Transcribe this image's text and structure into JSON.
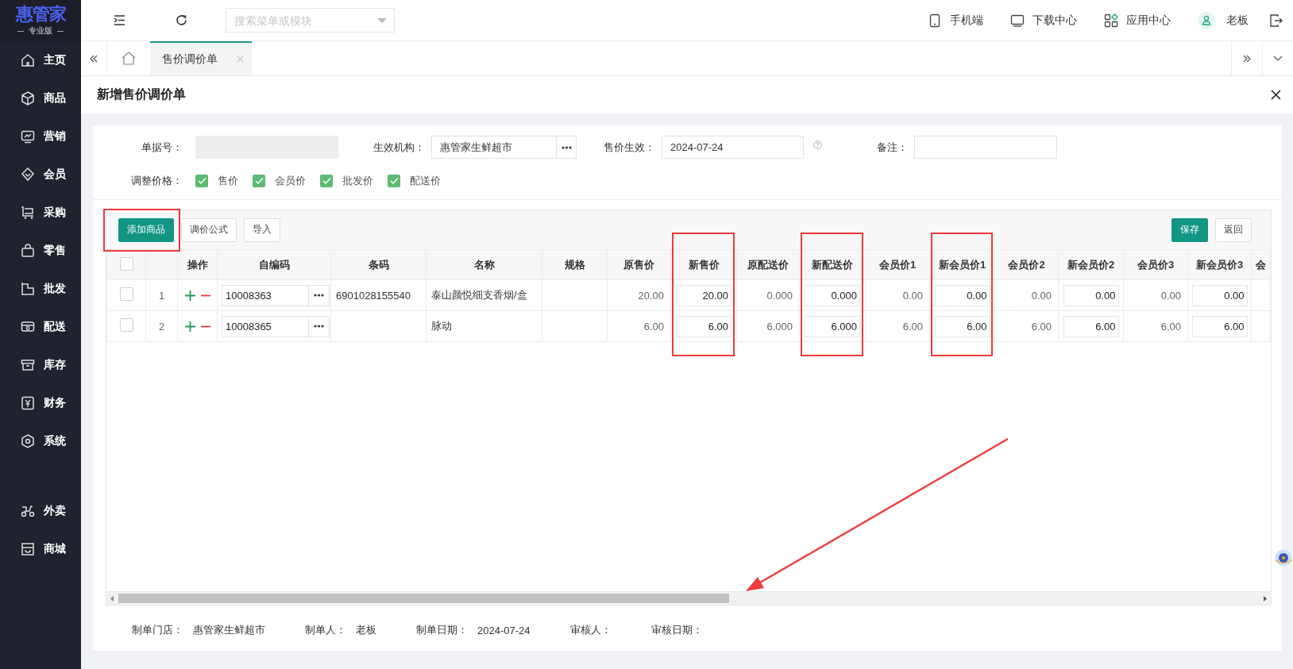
{
  "sidebar": {
    "logo": "惠管家",
    "edition": "专业版",
    "items": [
      {
        "label": "主页"
      },
      {
        "label": "商品"
      },
      {
        "label": "营销"
      },
      {
        "label": "会员"
      },
      {
        "label": "采购"
      },
      {
        "label": "零售"
      },
      {
        "label": "批发"
      },
      {
        "label": "配送"
      },
      {
        "label": "库存"
      },
      {
        "label": "财务"
      },
      {
        "label": "系统"
      }
    ],
    "bottom_items": [
      {
        "label": "外卖"
      },
      {
        "label": "商城"
      }
    ]
  },
  "topbar": {
    "search": {
      "placeholder": "搜索菜单或模块"
    },
    "links": [
      {
        "label": "手机端"
      },
      {
        "label": "下载中心"
      },
      {
        "label": "应用中心"
      }
    ],
    "user": "老板"
  },
  "tabs": [
    {
      "label": "售价调价单",
      "selected": true
    }
  ],
  "page": {
    "title": "新增售价调价单"
  },
  "form": {
    "fields": [
      {
        "label": "单据号：",
        "kind": "readonly"
      },
      {
        "label": "生效机构：",
        "kind": "lookup",
        "value": "惠管家生鲜超市"
      },
      {
        "label": "售价生效：",
        "kind": "date",
        "value": "2024-07-24"
      },
      {
        "label": "备注：",
        "kind": "text"
      }
    ],
    "adjust": {
      "label": "调整价格：",
      "options": [
        {
          "label": "售价",
          "checked": true
        },
        {
          "label": "会员价",
          "checked": true
        },
        {
          "label": "批发价",
          "checked": true
        },
        {
          "label": "配送价",
          "checked": true
        }
      ]
    }
  },
  "toolbar": {
    "left": [
      {
        "label": "添加商品",
        "kind": "primary",
        "highlighted": true
      },
      {
        "label": "调价公式",
        "kind": "default",
        "highlighted": false
      },
      {
        "label": "导入",
        "kind": "default",
        "highlighted": false
      }
    ],
    "right": [
      {
        "label": "保存",
        "kind": "primary",
        "highlighted": false
      },
      {
        "label": "返回",
        "kind": "default",
        "highlighted": false
      }
    ]
  },
  "table": {
    "all_checked": false,
    "ops_header": "操作",
    "columns": [
      {
        "label": "自编码",
        "kind": "lookup",
        "highlighted": false
      },
      {
        "label": "条码",
        "kind": "text",
        "highlighted": false
      },
      {
        "label": "名称",
        "kind": "text",
        "highlighted": false
      },
      {
        "label": "规格",
        "kind": "text",
        "highlighted": false
      },
      {
        "label": "原售价",
        "kind": "number",
        "highlighted": false
      },
      {
        "label": "新售价",
        "kind": "input",
        "highlighted": true
      },
      {
        "label": "原配送价",
        "kind": "number",
        "highlighted": false
      },
      {
        "label": "新配送价",
        "kind": "input",
        "highlighted": true
      },
      {
        "label": "会员价1",
        "kind": "number",
        "highlighted": false
      },
      {
        "label": "新会员价1",
        "kind": "input",
        "highlighted": true
      },
      {
        "label": "会员价2",
        "kind": "number",
        "highlighted": false
      },
      {
        "label": "新会员价2",
        "kind": "input",
        "highlighted": false
      },
      {
        "label": "会员价3",
        "kind": "number",
        "highlighted": false
      },
      {
        "label": "新会员价3",
        "kind": "input",
        "highlighted": false
      },
      {
        "label": "会",
        "kind": "number",
        "highlighted": false
      }
    ],
    "rows": [
      {
        "checked": false,
        "number": "1",
        "code": "10008363",
        "barcode": "6901028155540",
        "name": "泰山颜悦细支香烟/盒",
        "old_price": "20.00",
        "new_price": "20.00",
        "old_delivery": "0.000",
        "new_delivery": "0.000",
        "member1": "0.00",
        "new_member1": "0.00",
        "member2": "0.00",
        "new_member2": "0.00",
        "member3": "0.00",
        "new_member3": "0.00"
      },
      {
        "checked": false,
        "number": "2",
        "code": "10008365",
        "name": "脉动",
        "old_price": "6.00",
        "new_price": "6.00",
        "old_delivery": "6.000",
        "new_delivery": "6.000",
        "member1": "6.00",
        "new_member1": "6.00",
        "member2": "6.00",
        "new_member2": "6.00",
        "member3": "6.00",
        "new_member3": "6.00"
      }
    ]
  },
  "footer": [
    {
      "label": "制单门店：",
      "value": "惠管家生鲜超市"
    },
    {
      "label": "制单人：",
      "value": "老板"
    },
    {
      "label": "制单日期：",
      "value": "2024-07-24"
    },
    {
      "label": "审核人："
    },
    {
      "label": "审核日期："
    }
  ],
  "annotation_arrow": true
}
